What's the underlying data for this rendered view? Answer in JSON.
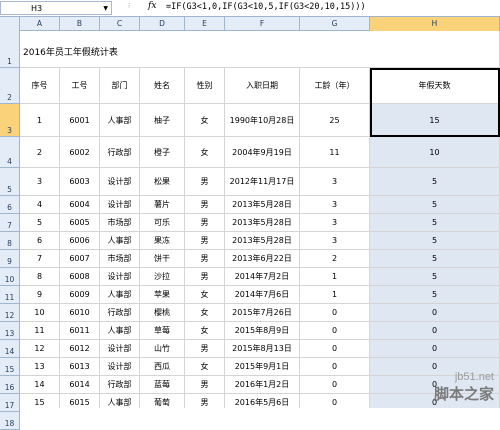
{
  "formula_bar": {
    "name_box": "H3",
    "fx_label": "fx",
    "formula": "=IF(G3<1,0,IF(G3<10,5,IF(G3<20,10,15)))"
  },
  "columns": [
    "A",
    "B",
    "C",
    "D",
    "E",
    "F",
    "G",
    "H"
  ],
  "active_column": "H",
  "row_numbers": [
    "1",
    "2",
    "3",
    "4",
    "5",
    "6",
    "7",
    "8",
    "9",
    "10",
    "11",
    "12",
    "13",
    "14",
    "15",
    "16",
    "17",
    "18"
  ],
  "active_row": "3",
  "sheet": {
    "title": "2016年员工年假统计表",
    "headers": [
      "序号",
      "工号",
      "部门",
      "姓名",
      "性别",
      "入职日期",
      "工龄（年）",
      "年假天数"
    ],
    "rows": [
      [
        "1",
        "6001",
        "人事部",
        "柚子",
        "女",
        "1990年10月28日",
        "25",
        "15"
      ],
      [
        "2",
        "6002",
        "行政部",
        "橙子",
        "女",
        "2004年9月19日",
        "11",
        "10"
      ],
      [
        "3",
        "6003",
        "设计部",
        "松果",
        "男",
        "2012年11月17日",
        "3",
        "5"
      ],
      [
        "4",
        "6004",
        "设计部",
        "薯片",
        "男",
        "2013年5月28日",
        "3",
        "5"
      ],
      [
        "5",
        "6005",
        "市场部",
        "可乐",
        "男",
        "2013年5月28日",
        "3",
        "5"
      ],
      [
        "6",
        "6006",
        "人事部",
        "果冻",
        "男",
        "2013年5月28日",
        "3",
        "5"
      ],
      [
        "7",
        "6007",
        "市场部",
        "饼干",
        "男",
        "2013年6月22日",
        "2",
        "5"
      ],
      [
        "8",
        "6008",
        "设计部",
        "沙拉",
        "男",
        "2014年7月2日",
        "1",
        "5"
      ],
      [
        "9",
        "6009",
        "人事部",
        "苹果",
        "女",
        "2014年7月6日",
        "1",
        "5"
      ],
      [
        "10",
        "6010",
        "行政部",
        "樱桃",
        "女",
        "2015年7月26日",
        "0",
        "0"
      ],
      [
        "11",
        "6011",
        "人事部",
        "草莓",
        "女",
        "2015年8月9日",
        "0",
        "0"
      ],
      [
        "12",
        "6012",
        "设计部",
        "山竹",
        "男",
        "2015年8月13日",
        "0",
        "0"
      ],
      [
        "13",
        "6013",
        "设计部",
        "西瓜",
        "女",
        "2015年9月1日",
        "0",
        "0"
      ],
      [
        "14",
        "6014",
        "行政部",
        "蓝莓",
        "男",
        "2016年1月2日",
        "0",
        "0"
      ],
      [
        "15",
        "6015",
        "人事部",
        "葡萄",
        "男",
        "2016年5月6日",
        "0",
        "0"
      ]
    ]
  },
  "watermark": {
    "url": "jb51.net",
    "name": "脚本之家"
  },
  "colors": {
    "header_bg": "#e4ecf7",
    "active_header": "#f9d27a",
    "selected_column_fill": "#dfe7f3",
    "gridline": "#d4d4d4"
  }
}
